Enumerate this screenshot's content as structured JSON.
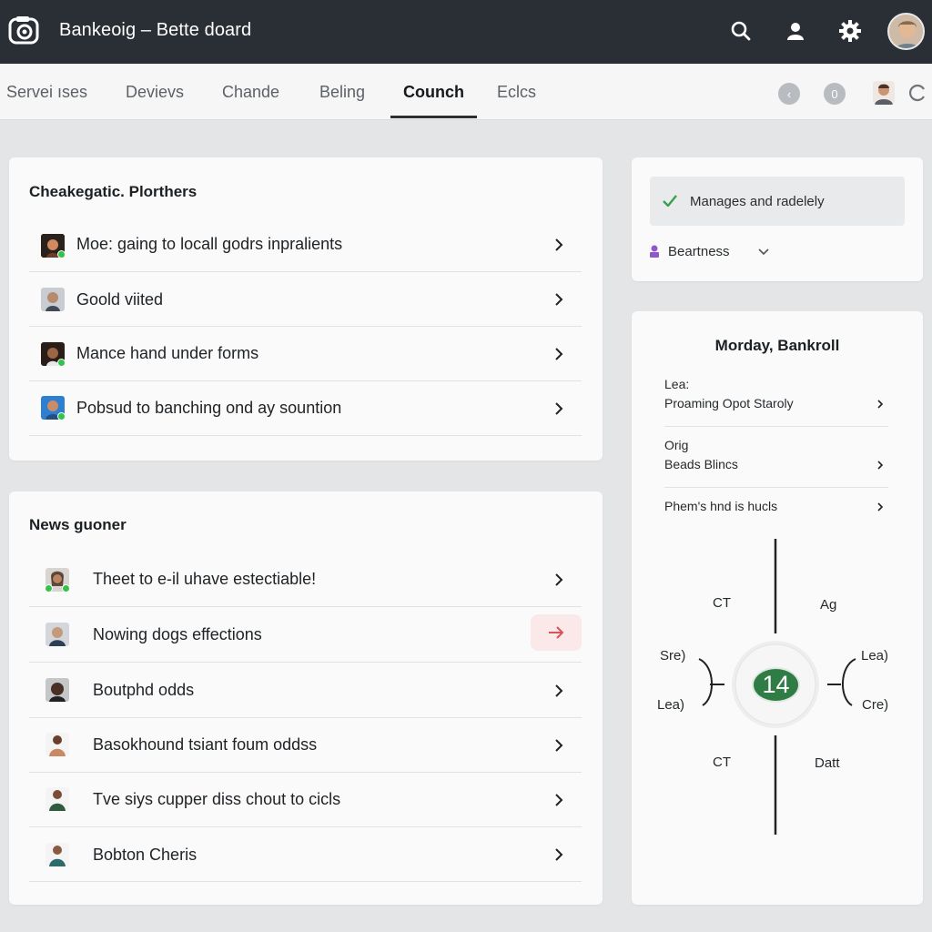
{
  "header": {
    "title": "Bankeoig – Bette doard",
    "icons": [
      "logo-icon",
      "search-icon",
      "user-icon",
      "gear-icon",
      "avatar"
    ]
  },
  "tabs": [
    {
      "label": "Servei ıses",
      "active": false
    },
    {
      "label": "Devievs",
      "active": false
    },
    {
      "label": "Chande",
      "active": false
    },
    {
      "label": "Beling",
      "active": false
    },
    {
      "label": "Counch",
      "active": true
    },
    {
      "label": "Eclcs",
      "active": false
    }
  ],
  "tab_actions": {
    "circle_1": "‹",
    "circle_2": "0"
  },
  "card1": {
    "title": "Cheakegatic. Plorthers",
    "items": [
      {
        "label": "Moe: gaing to locall godrs inpralients"
      },
      {
        "label": "Goold viited"
      },
      {
        "label": "Mance hand under forms"
      },
      {
        "label": "Pobsud to banching ond ay sountion"
      }
    ]
  },
  "card2": {
    "title": "News guoner",
    "items": [
      {
        "label": "Theet to e-il uhave estectiable!"
      },
      {
        "label": "Nowing dogs effections"
      },
      {
        "label": "Boutphd odds"
      },
      {
        "label": "Basokhound tsiant foum oddss"
      },
      {
        "label": "Tve siys cupper diss chout to cicls"
      },
      {
        "label": "Bobton Cheris"
      }
    ]
  },
  "right_top": {
    "check_label": "Manages and radelely",
    "select_label": "Beartness"
  },
  "right_bottom": {
    "title": "Morday, Bankroll",
    "rows": [
      {
        "line1": "Lea:",
        "line2": "Proaming Opot Staroly"
      },
      {
        "line1": "Orig",
        "line2": "Beads Blincs"
      },
      {
        "line1": "Phem's hnd is hucls",
        "line2": ""
      }
    ],
    "dial": {
      "value": "14",
      "top_left": "CT",
      "top_right": "Ag",
      "mid_left_top": "Sre)",
      "mid_left_bottom": "Lea)",
      "mid_right_top": "Lea)",
      "mid_right_bottom": "Cre)",
      "bottom_left": "CT",
      "bottom_right": "Datt"
    }
  },
  "colors": {
    "topbar": "#2a2f36",
    "online": "#35c24b",
    "check": "#3aa04a",
    "dial_green": "#2f7d45",
    "accent_red": "#d9535a"
  }
}
